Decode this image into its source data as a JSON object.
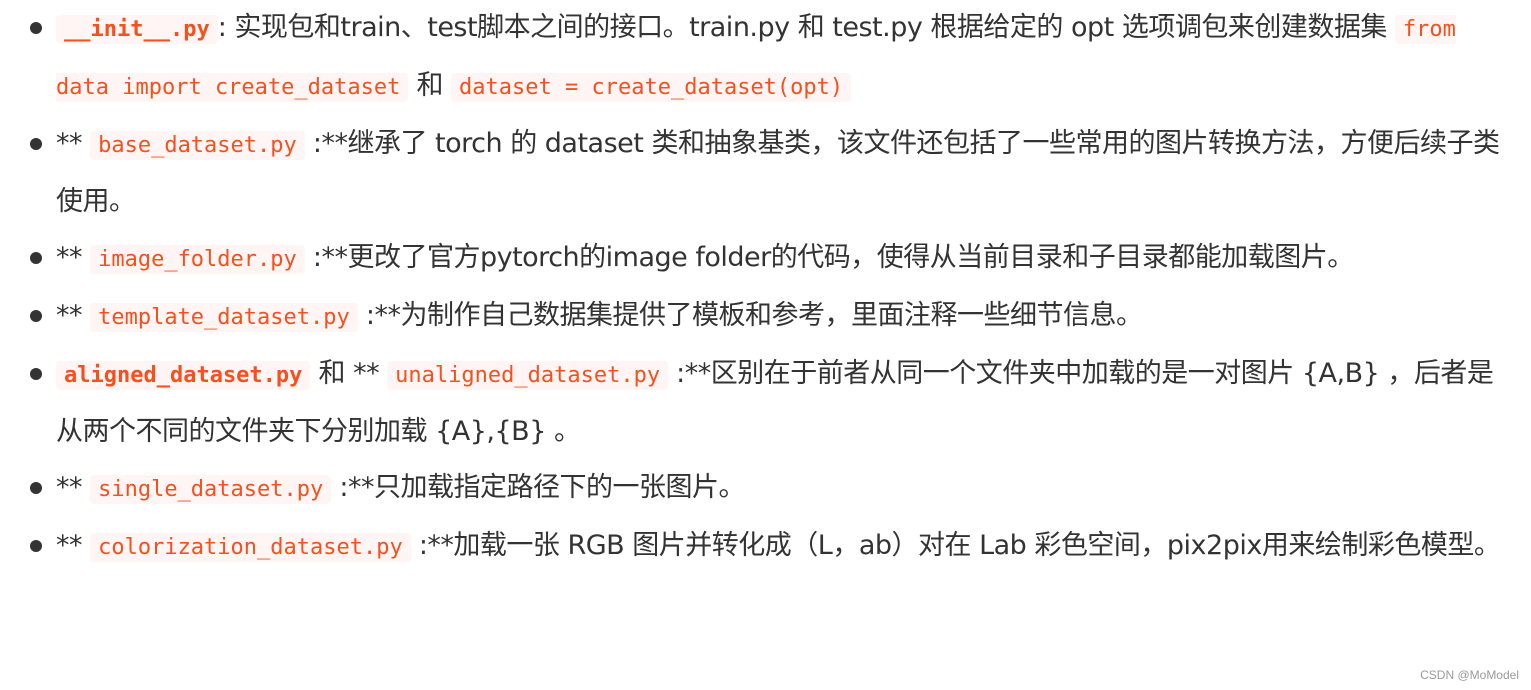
{
  "items": [
    {
      "code1": "__init__.py",
      "text1": ": 实现包和train、test脚本之间的接口。train.py 和 test.py 根据给定的 opt 选项调包来创建数据集 ",
      "code2": "from data import create_dataset",
      "text2": " 和 ",
      "code3": "dataset = create_dataset(opt)"
    },
    {
      "prefix": "** ",
      "code1": "base_dataset.py",
      "text1": " :**继承了 torch 的 dataset 类和抽象基类，该文件还包括了一些常用的图片转换方法，方便后续子类使用。"
    },
    {
      "prefix": "** ",
      "code1": "image_folder.py",
      "text1": " :**更改了官方pytorch的image folder的代码，使得从当前目录和子目录都能加载图片。"
    },
    {
      "prefix": "** ",
      "code1": "template_dataset.py",
      "text1": " :**为制作自己数据集提供了模板和参考，里面注释一些细节信息。"
    },
    {
      "code1": "aligned_dataset.py",
      "text1": " 和 ** ",
      "code2": "unaligned_dataset.py",
      "text2": " :**区别在于前者从同一个文件夹中加载的是一对图片 {A,B} ，后者是从两个不同的文件夹下分别加载 {A},{B} 。"
    },
    {
      "prefix": "** ",
      "code1": "single_dataset.py",
      "text1": " :**只加载指定路径下的一张图片。"
    },
    {
      "prefix": "** ",
      "code1": "colorization_dataset.py",
      "text1": " :**加载一张 RGB 图片并转化成（L，ab）对在 Lab 彩色空间，pix2pix用来绘制彩色模型。"
    }
  ],
  "watermark": "CSDN @MoModel",
  "colors": {
    "code_text": "#f4511e",
    "code_bg": "#fff5f4",
    "body_text": "#333333"
  }
}
